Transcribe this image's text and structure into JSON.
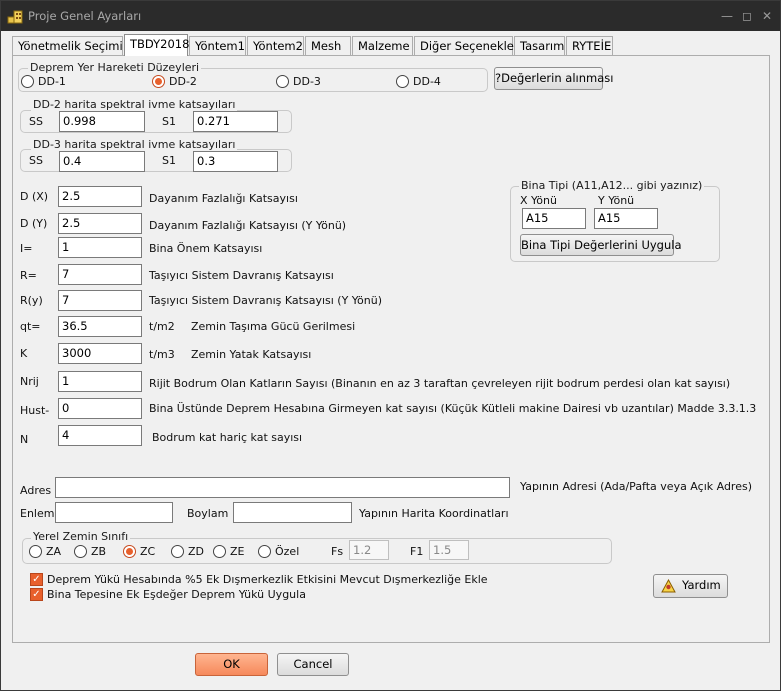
{
  "window": {
    "title": "Proje Genel Ayarları"
  },
  "tabs": [
    "Yönetmelik Seçimi",
    "TBDY2018",
    "Yöntem1",
    "Yöntem2",
    "Mesh",
    "Malzeme",
    "Diğer Seçenekler",
    "Tasarım",
    "RYTEİE"
  ],
  "deprem": {
    "title": "Deprem Yer Hareketi Düzeyleri",
    "options": [
      "DD-1",
      "DD-2",
      "DD-3",
      "DD-4"
    ],
    "selected": "DD-2",
    "get_values_button": "?Değerlerin alınması"
  },
  "dd2": {
    "title": "DD-2  harita spektral ivme katsayıları",
    "ss_label": "SS",
    "ss": "0.998",
    "s1_label": "S1",
    "s1": "0.271"
  },
  "dd3": {
    "title": "DD-3 harita spektral ivme katsayıları",
    "ss_label": "SS",
    "ss": "0.4",
    "s1_label": "S1",
    "s1": "0.3"
  },
  "params": [
    {
      "label": "D (X)",
      "value": "2.5",
      "desc": "Dayanım Fazlalığı Katsayısı"
    },
    {
      "label": "D (Y)",
      "value": "2.5",
      "desc": "Dayanım Fazlalığı Katsayısı (Y Yönü)"
    },
    {
      "label": "I=",
      "value": "1",
      "desc": "Bina Önem Katsayısı"
    },
    {
      "label": "R=",
      "value": "7",
      "desc": "Taşıyıcı Sistem Davranış Katsayısı"
    },
    {
      "label": "R(y)",
      "value": "7",
      "desc": "Taşıyıcı Sistem Davranış Katsayısı  (Y Yönü)"
    },
    {
      "label": "qt=",
      "value": "36.5",
      "unit": "t/m2",
      "desc": "Zemin Taşıma Gücü Gerilmesi"
    },
    {
      "label": "K",
      "value": "3000",
      "unit": "t/m3",
      "desc": "Zemin Yatak Katsayısı"
    },
    {
      "label": "Nrij",
      "value": "1",
      "desc": "Rijit Bodrum Olan Katların Sayısı (Binanın en az 3 taraftan çevreleyen rijit bodrum perdesi olan kat sayısı)"
    },
    {
      "label": "Hust-",
      "value": "0",
      "desc": "Bina Üstünde Deprem Hesabına Girmeyen kat sayısı (Küçük Kütleli makine Dairesi vb uzantılar) Madde 3.3.1.3"
    },
    {
      "label": "N",
      "value": "4",
      "desc": "Bodrum kat hariç kat sayısı"
    }
  ],
  "bina_tipi": {
    "title": "Bina Tipi (A11,A12... gibi yazınız)",
    "x_label": "X Yönü",
    "y_label": "Y Yönü",
    "x_value": "A15",
    "y_value": "A15",
    "apply_button": "Bina Tipi Değerlerini Uygula"
  },
  "address": {
    "adres_label": "Adres",
    "adres_value": "",
    "adres_desc": "Yapının Adresi (Ada/Pafta veya Açık Adres)",
    "enlem_label": "Enlem",
    "enlem_value": "",
    "boylam_label": "Boylam",
    "boylam_value": "",
    "coords_desc": "Yapının Harita Koordinatları"
  },
  "zemin": {
    "title": "Yerel Zemin Sınıfı",
    "options": [
      "ZA",
      "ZB",
      "ZC",
      "ZD",
      "ZE",
      "Özel"
    ],
    "selected": "ZC",
    "fs_label": "Fs",
    "fs_value": "1.2",
    "f1_label": "F1",
    "f1_value": "1.5"
  },
  "checks": [
    {
      "label": "Deprem Yükü  Hesabında %5 Ek Dışmerkezlik Etkisini Mevcut Dışmerkezliğe Ekle",
      "checked": true
    },
    {
      "label": "Bina Tepesine Ek Eşdeğer Deprem Yükü Uygula",
      "checked": true
    }
  ],
  "help_button": "Yardım",
  "ok_button": "OK",
  "cancel_button": "Cancel",
  "colors": {
    "accent": "#e8602c",
    "titlebar": "#2b2b2b",
    "face": "#f0f0f0"
  }
}
